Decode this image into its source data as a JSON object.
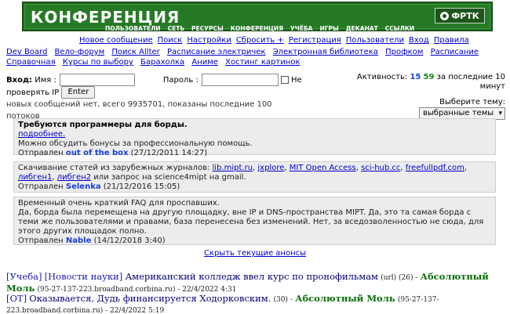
{
  "header": {
    "logo": "КОНФЕРЕНЦИЯ",
    "brand": "ФРТК",
    "menu": [
      "ПОЛЬЗОВАТЕЛИ",
      "СЕТЬ",
      "РЕСУРСЫ",
      "КОНФЕРЕНЦИЯ",
      "УЧЁБА",
      "ИГРЫ",
      "ДЕКАНАТ",
      "ССЫЛКИ"
    ]
  },
  "nav1": [
    "Новое сообщение",
    "Поиск",
    "Настройки",
    "Сбросить +",
    "Регистрация",
    "Пользователи",
    "Вход",
    "Правила"
  ],
  "nav2": [
    "Dev Board",
    "Вело-форум",
    "Поиск Allter",
    "Расписание электричек",
    "Электронная библиотека",
    "Профком",
    "Расписание",
    "Справочная",
    "Курсы по выбору",
    "Барахолка",
    "Аниме",
    "Хостинг картинок"
  ],
  "login": {
    "label": "Вход:",
    "name_label": "Имя :",
    "pass_label": "Пароль :",
    "ip_label_1": "Не",
    "ip_label_2": "проверять IP",
    "enter": "Enter",
    "status": "новых сообщений нет, всего 9935701, показаны последние 100 потоков"
  },
  "activity": {
    "label": "Активность:",
    "v1": "15",
    "v2": "59",
    "suffix": "за последние 10 минут",
    "topic_label": "Выберите тему:",
    "topic_value": "выбранные темы"
  },
  "announcements": [
    {
      "title": "Требуются программеры для борды.",
      "link": "подробнее.",
      "text": "Можно обсудить бонусы за профессиональную помощь.",
      "sent": "Отправлен",
      "author": "out of the box",
      "date": "(27/12/2011 14:27)"
    },
    {
      "text": "Скачивание статей из зарубежных журналов:",
      "links": [
        "lib.mipt.ru",
        "jxplore",
        "MIT Open Access",
        "sci-hub.cc",
        "freefullpdf.com",
        "либген1",
        "либген2"
      ],
      "tail": "или запрос на science4mipt на gmail.",
      "sent": "Отправлен",
      "author": "Selenka",
      "date": "(21/12/2016 15:05)"
    },
    {
      "line1": "Временный очень краткий FAQ для проспавших.",
      "text": "Да, борда была перемещена на другую площадку, вне IP и DNS-пространства MIPT. Да, это та самая борда с теми же пользователями и правами, база перенесена без изменений. Нет, за вседозволенностью не сюда, для этого других площадок полно.",
      "sent": "Отправлен",
      "author": "Nable",
      "date": "(14/12/2018 3:40)"
    }
  ],
  "hide_announcements": "Скрыть текущие анонсы",
  "posts": [
    {
      "cats": [
        "[Учеба]",
        "[Новости науки]"
      ],
      "title": "Американский колледж ввел курс по пронофильмам",
      "meta": "(url) (26) -",
      "author": "Абсолютный Моль",
      "host": "(95-27-137-223.broadband.corbina.ru) - 22/4/2022 4:31"
    },
    {
      "cats": [
        "[ОТ]"
      ],
      "title": "Оказывается, Дудь финансируется Ходорковским.",
      "meta": "(30) -",
      "author": "Абсолютный Моль",
      "host": "(95-27-137-223.broadband.corbina.ru) - 22/4/2022 5:19"
    }
  ],
  "colors": {
    "banner": "#267a26",
    "link": "#0000cc",
    "author": "#1a3fd9",
    "moderator": "#0b6e0b"
  }
}
